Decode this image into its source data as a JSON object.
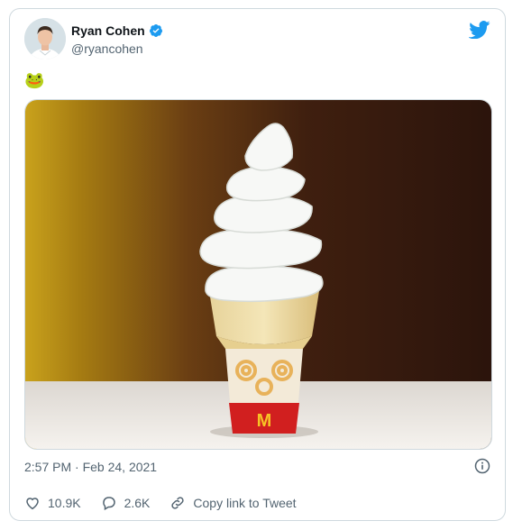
{
  "tweet": {
    "author": {
      "name": "Ryan Cohen",
      "handle": "@ryancohen",
      "verified": true,
      "avatar": "avatar-man-portrait"
    },
    "text": "🐸",
    "media": {
      "description_icon": "ice-cream-cone-photo"
    },
    "timestamp": "2:57 PM · Feb 24, 2021",
    "actions": {
      "likes": "10.9K",
      "replies": "2.6K",
      "copy_link": "Copy link to Tweet"
    }
  },
  "colors": {
    "brand": "#1d9bf0",
    "secondary_text": "#536471",
    "border": "#cfd9de"
  },
  "icons": [
    "verified-badge-icon",
    "twitter-bird-icon",
    "info-icon",
    "heart-icon",
    "reply-icon",
    "link-icon"
  ]
}
